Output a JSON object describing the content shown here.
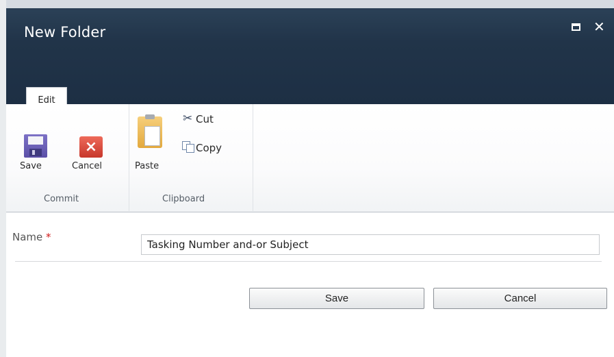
{
  "window": {
    "title": "New Folder",
    "maximize_icon": "maximize-icon",
    "close_icon": "close-icon",
    "close_glyph": "✕"
  },
  "ribbon": {
    "active_tab": "Edit",
    "groups": [
      {
        "label": "Commit",
        "buttons": [
          {
            "label": "Save",
            "icon": "save-icon"
          },
          {
            "label": "Cancel",
            "icon": "cancel-icon"
          }
        ]
      },
      {
        "label": "Clipboard",
        "buttons": [
          {
            "label": "Paste",
            "icon": "paste-icon"
          },
          {
            "label": "Cut",
            "icon": "cut-icon"
          },
          {
            "label": "Copy",
            "icon": "copy-icon"
          }
        ]
      }
    ]
  },
  "form": {
    "name_label": "Name",
    "required_marker": "*",
    "name_value": "Tasking Number and-or Subject"
  },
  "actions": {
    "save_label": "Save",
    "cancel_label": "Cancel"
  },
  "colors": {
    "title_bar": "#1f3246",
    "required": "#d11a1a"
  }
}
